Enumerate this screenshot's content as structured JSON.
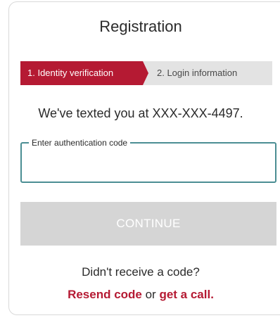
{
  "header": {
    "title": "Registration"
  },
  "steps": [
    {
      "label": "1. Identity verification",
      "active": true
    },
    {
      "label": "2. Login information",
      "active": false
    }
  ],
  "message": {
    "sent_text": "We've texted you at XXX-XXX-4497."
  },
  "code_field": {
    "label": "Enter authentication code",
    "value": "",
    "placeholder": ""
  },
  "continue_button": {
    "label": "CONTINUE",
    "enabled": false
  },
  "resend": {
    "question": "Didn't receive a code?",
    "resend_link": "Resend code",
    "or_text": " or ",
    "call_link": "get a call."
  },
  "colors": {
    "accent": "#b51a33",
    "step_inactive": "#e3e3e3",
    "field_border": "#4b8e93",
    "button_disabled": "#d5d5d5"
  }
}
